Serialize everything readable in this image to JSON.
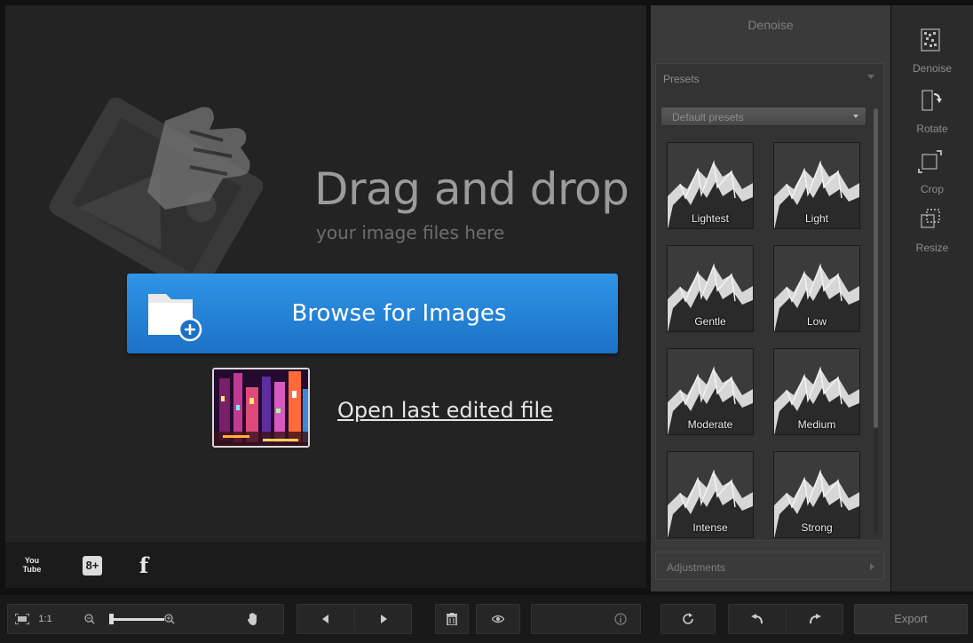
{
  "canvas": {
    "drag_title": "Drag and drop",
    "drag_subtitle": "your image files here",
    "browse_label": "Browse for Images",
    "open_last_label": "Open last edited file"
  },
  "social": {
    "youtube_text": "You Tube",
    "googleplus_text": "8+",
    "facebook_text": "f"
  },
  "panel": {
    "title": "Denoise",
    "presets_header": "Presets",
    "presets_select": "Default presets",
    "presets": [
      {
        "label": "Lightest"
      },
      {
        "label": "Light"
      },
      {
        "label": "Gentle"
      },
      {
        "label": "Low"
      },
      {
        "label": "Moderate"
      },
      {
        "label": "Medium"
      },
      {
        "label": "Intense"
      },
      {
        "label": "Strong"
      }
    ],
    "adjustments_header": "Adjustments"
  },
  "tools": [
    {
      "label": "Denoise",
      "icon": "denoise-icon"
    },
    {
      "label": "Rotate",
      "icon": "rotate-icon"
    },
    {
      "label": "Crop",
      "icon": "crop-icon"
    },
    {
      "label": "Resize",
      "icon": "resize-icon"
    }
  ],
  "bottom": {
    "zoom_label": "1:1",
    "export_label": "Export"
  },
  "colors": {
    "accent_blue": "#2f95e6",
    "panel_bg": "#3a3a3a",
    "canvas_bg": "#232323"
  }
}
